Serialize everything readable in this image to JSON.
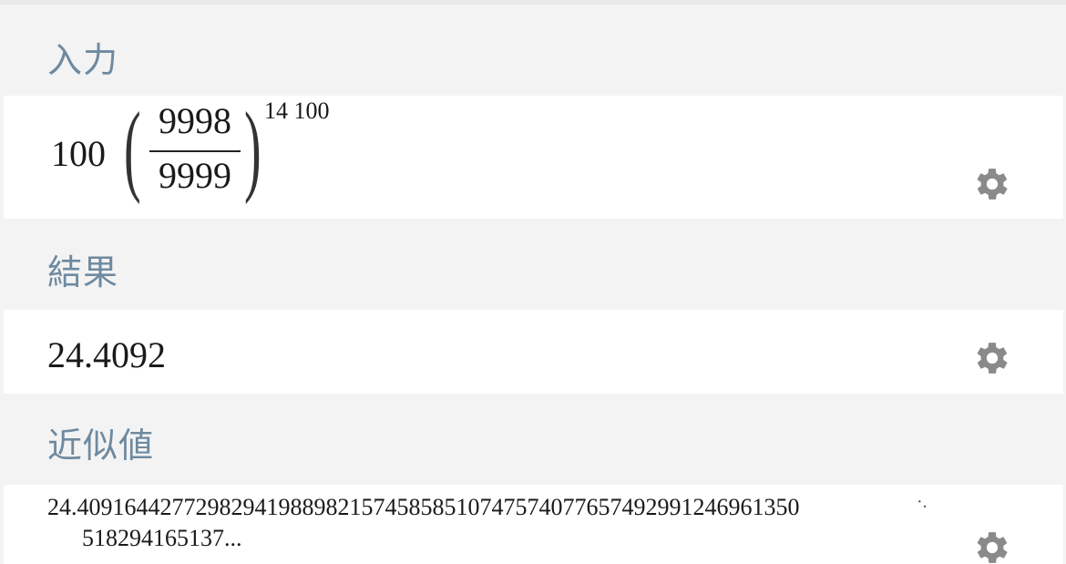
{
  "pods": {
    "input": {
      "title": "入力",
      "coefficient": "100",
      "numerator": "9998",
      "denominator": "9999",
      "exponent": "14 100",
      "gear_icon": "gear-icon"
    },
    "result": {
      "title": "結果",
      "value": "24.4092",
      "gear_icon": "gear-icon"
    },
    "approx": {
      "title": "近似値",
      "line1": "24.409164427729829419889821574585851074757407765749299124696135​0",
      "continuation": "·.",
      "line2": "518294165137...",
      "gear_icon": "gear-icon"
    }
  },
  "colors": {
    "title": "#6e8aa0",
    "header_bg": "#f3f3f3",
    "body_bg": "#ffffff",
    "gear": "#8a8a8a",
    "text": "#1a1a1a"
  }
}
